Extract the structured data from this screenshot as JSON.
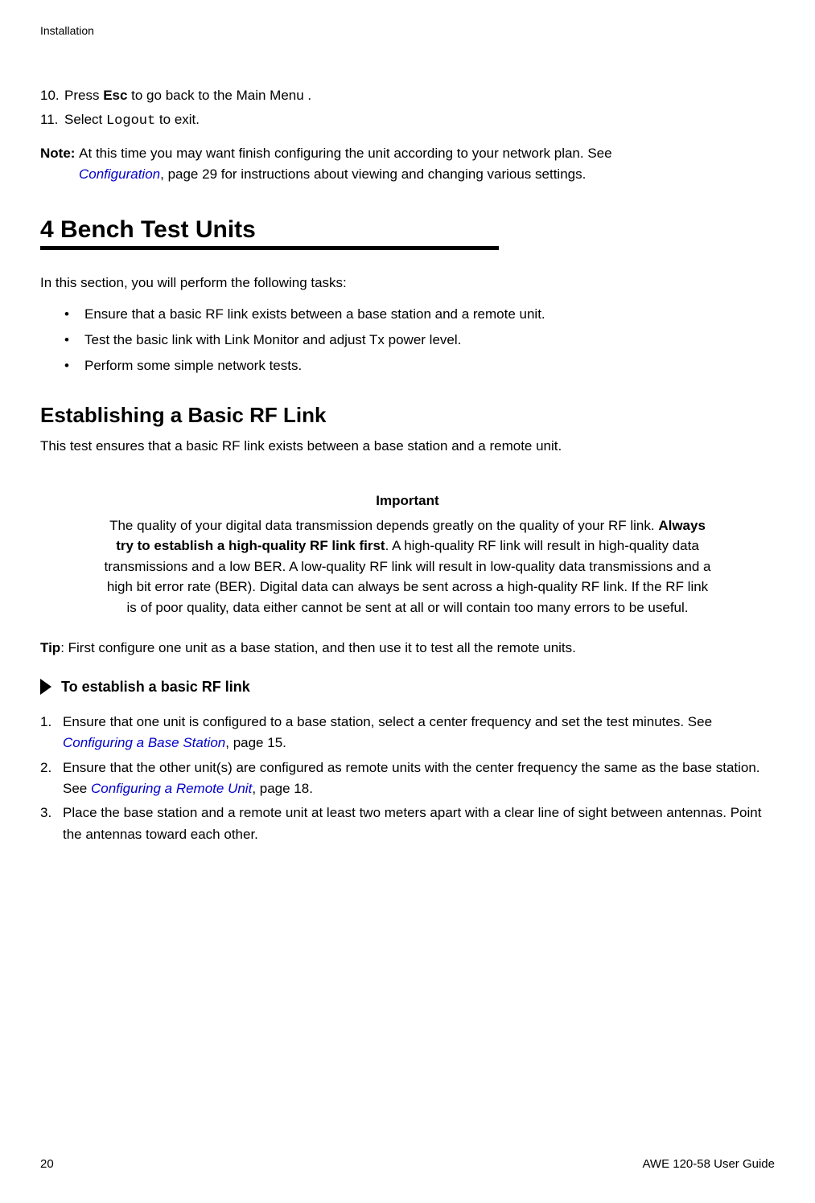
{
  "header": {
    "section_name": "Installation"
  },
  "steps": {
    "step10_num": "10.",
    "step10_prefix": "Press ",
    "step10_bold": "Esc",
    "step10_suffix": " to go back to the Main Menu .",
    "step11_num": "11.",
    "step11_prefix": "Select ",
    "step11_mono": "Logout",
    "step11_suffix": " to exit."
  },
  "note": {
    "label": "Note: ",
    "line1": "At this time you may want finish configuring the unit according to your network plan. See ",
    "link": "Configuration",
    "line2": ", page 29 for instructions about viewing and changing various settings."
  },
  "section": {
    "heading": "4 Bench Test Units",
    "intro": "In this section, you will perform the following tasks:",
    "bullets": [
      "Ensure that a basic RF link exists between a base station and a remote unit.",
      "Test the basic link with Link Monitor and adjust Tx power level.",
      "Perform some simple network tests."
    ]
  },
  "subsection": {
    "heading": "Establishing a Basic RF Link",
    "body": "This test ensures that a basic RF link exists between a base station and a remote unit."
  },
  "important": {
    "heading": "Important",
    "text_prefix": "The quality of your digital data transmission depends greatly on the quality of your RF link. ",
    "text_bold": "Always try to establish a high-quality RF link first",
    "text_suffix": ". A high-quality RF link will result in high-quality data transmissions and a low BER. A low-quality RF link will result in low-quality data transmissions and a high bit error rate (BER). Digital data can always be sent across a high-quality RF link. If the RF link is of poor quality, data either cannot be sent at all or will contain too many errors to be useful."
  },
  "tip": {
    "label": "Tip",
    "text": ": First configure one unit as a base station, and then use it to test all the remote units."
  },
  "procedure": {
    "title": "To establish a basic RF link",
    "items": [
      {
        "num": "1.",
        "prefix": "Ensure that one unit is configured to a base station, select a center frequency and set the test minutes. See ",
        "link": "Configuring a Base Station",
        "suffix": ", page 15."
      },
      {
        "num": "2.",
        "prefix": "Ensure that the other unit(s) are configured as remote units with the center frequency the same as the base station. See ",
        "link": "Configuring a Remote Unit",
        "suffix": ", page 18."
      },
      {
        "num": "3.",
        "prefix": "Place the base station and a remote unit at least two meters apart with a clear line of sight between antennas. Point the antennas toward each other.",
        "link": "",
        "suffix": ""
      }
    ]
  },
  "footer": {
    "page_number": "20",
    "guide_name": "AWE 120-58 User Guide"
  }
}
